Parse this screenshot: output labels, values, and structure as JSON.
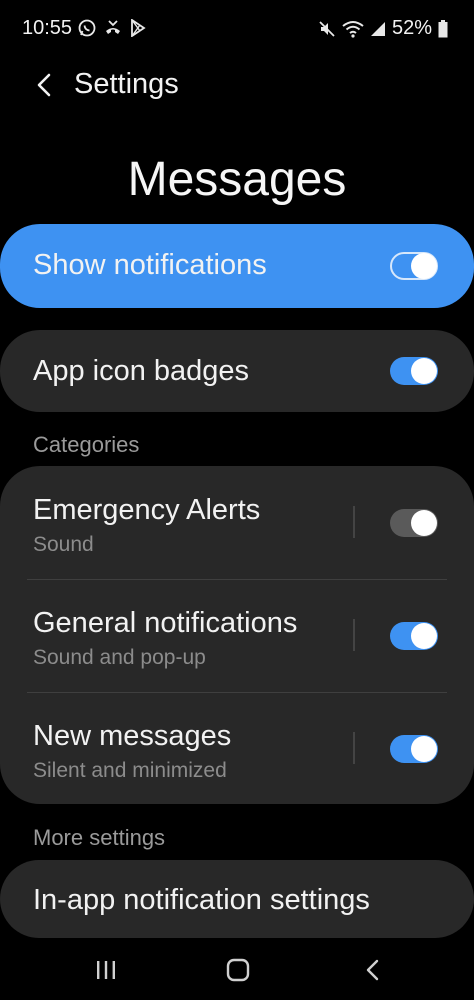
{
  "status_bar": {
    "time": "10:55",
    "battery": "52%",
    "left_icons": [
      "whatsapp-icon",
      "missed-call-icon",
      "play-store-icon"
    ],
    "right_icons": [
      "mute-icon",
      "wifi-icon",
      "signal-icon",
      "battery-icon"
    ]
  },
  "header": {
    "back_label": "Settings",
    "page_title": "Messages"
  },
  "show_notifications": {
    "label": "Show notifications",
    "enabled": true
  },
  "app_icon_badges": {
    "label": "App icon badges",
    "enabled": true
  },
  "categories": {
    "section_label": "Categories",
    "items": [
      {
        "title": "Emergency Alerts",
        "subtitle": "Sound",
        "enabled": false
      },
      {
        "title": "General notifications",
        "subtitle": "Sound and pop-up",
        "enabled": true
      },
      {
        "title": "New messages",
        "subtitle": "Silent and minimized",
        "enabled": true
      }
    ]
  },
  "more_settings": {
    "section_label": "More settings",
    "in_app_label": "In-app notification settings"
  },
  "nav": [
    "recent-apps-icon",
    "home-icon",
    "back-icon"
  ],
  "colors": {
    "accent": "#3e92f2",
    "card": "#282828",
    "background": "#000000"
  }
}
